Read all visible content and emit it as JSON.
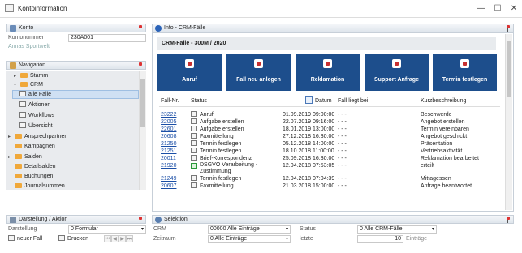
{
  "window": {
    "title": "Kontoinformation",
    "minimize": "—",
    "maximize": "☐",
    "close": "✕"
  },
  "konto": {
    "header": "Konto",
    "kontonummer_label": "Kontonummer",
    "kontonummer_value": "230A001",
    "name_link": "Annas Sportwelt"
  },
  "navigation": {
    "header": "Navigation",
    "items": [
      {
        "label": "Stamm",
        "type": "folder",
        "arrow": "▸"
      },
      {
        "label": "CRM",
        "type": "folder",
        "arrow": "▾"
      },
      {
        "label": "alle Fälle",
        "type": "page",
        "selected": true
      },
      {
        "label": "Aktionen",
        "type": "page"
      },
      {
        "label": "Workflows",
        "type": "page"
      },
      {
        "label": "Übersicht",
        "type": "page"
      },
      {
        "label": "Ansprechpartner",
        "type": "folder",
        "arrow": "▸"
      },
      {
        "label": "Kampagnen",
        "type": "folder"
      },
      {
        "label": "Salden",
        "type": "folder",
        "arrow": "▸"
      },
      {
        "label": "Detailsalden",
        "type": "folder"
      },
      {
        "label": "Buchungen",
        "type": "folder"
      },
      {
        "label": "Journalsummen",
        "type": "folder"
      }
    ]
  },
  "darstellung": {
    "header": "Darstellung / Aktion",
    "label": "Darstellung",
    "value": "0 Formular",
    "new_case": "neuer Fall",
    "print": "Drucken"
  },
  "info": {
    "header": "Info - CRM-Fälle",
    "subtitle": "CRM-Fälle - 300M / 2020"
  },
  "tiles": [
    "Anruf",
    "Fall neu anlegen",
    "Reklamation",
    "Support Anfrage",
    "Termin festlegen"
  ],
  "table": {
    "headers": {
      "nr": "Fall-Nr.",
      "status": "Status",
      "datum": "Datum",
      "bei": "Fall liegt bei",
      "kurz": "Kurzbeschreibung"
    },
    "rows": [
      {
        "nr": "23222",
        "status": "Anruf",
        "datum": "01.09.2019 09:00:00",
        "bei": "- - -",
        "kurz": "Beschwerde"
      },
      {
        "nr": "22005",
        "status": "Aufgabe erstellen",
        "datum": "22.07.2019 09:16:00",
        "bei": "- - -",
        "kurz": "Angebot erstellen"
      },
      {
        "nr": "22601",
        "status": "Aufgabe erstellen",
        "datum": "18.01.2019 13:00:00",
        "bei": "- - -",
        "kurz": "Termin vereinbaren"
      },
      {
        "nr": "20608",
        "status": "Faxmitteilung",
        "datum": "27.12.2018 16:30:00",
        "bei": "- - -",
        "kurz": "Angebot geschickt"
      },
      {
        "nr": "21250",
        "status": "Termin festlegen",
        "datum": "05.12.2018 14:00:00",
        "bei": "- - -",
        "kurz": "Präsentation"
      },
      {
        "nr": "21251",
        "status": "Termin festlegen",
        "datum": "18.10.2018 11:00:00",
        "bei": "- - -",
        "kurz": "Vertriebsaktivität"
      },
      {
        "nr": "20011",
        "status": "Brief-Korrespondenz",
        "datum": "25.09.2018 16:30:00",
        "bei": "- - -",
        "kurz": "Reklamation bearbeitet"
      },
      {
        "nr": "21920",
        "status": "DSGVO Verarbeitung - Zustimmung",
        "datum": "12.04.2018 07:53:05",
        "bei": "- - -",
        "kurz": "erteilt"
      },
      {
        "nr": "21249",
        "status": "Termin festlegen",
        "datum": "12.04.2018 07:04:39",
        "bei": "- - -",
        "kurz": "Mittagessen"
      },
      {
        "nr": "20607",
        "status": "Faxmitteilung",
        "datum": "21.03.2018 15:00:00",
        "bei": "- - -",
        "kurz": "Anfrage beantwortet"
      }
    ]
  },
  "selektion": {
    "header": "Selektion",
    "crm_label": "CRM",
    "crm_value": "00000 Alle Einträge",
    "zeitraum_label": "Zeitraum",
    "zeitraum_value": "0 Alle Einträge",
    "status_label": "Status",
    "status_value": "0 Alle CRM-Fälle",
    "letzte_label": "letzte",
    "letzte_value": "10",
    "eintraege_label": "Einträge"
  }
}
